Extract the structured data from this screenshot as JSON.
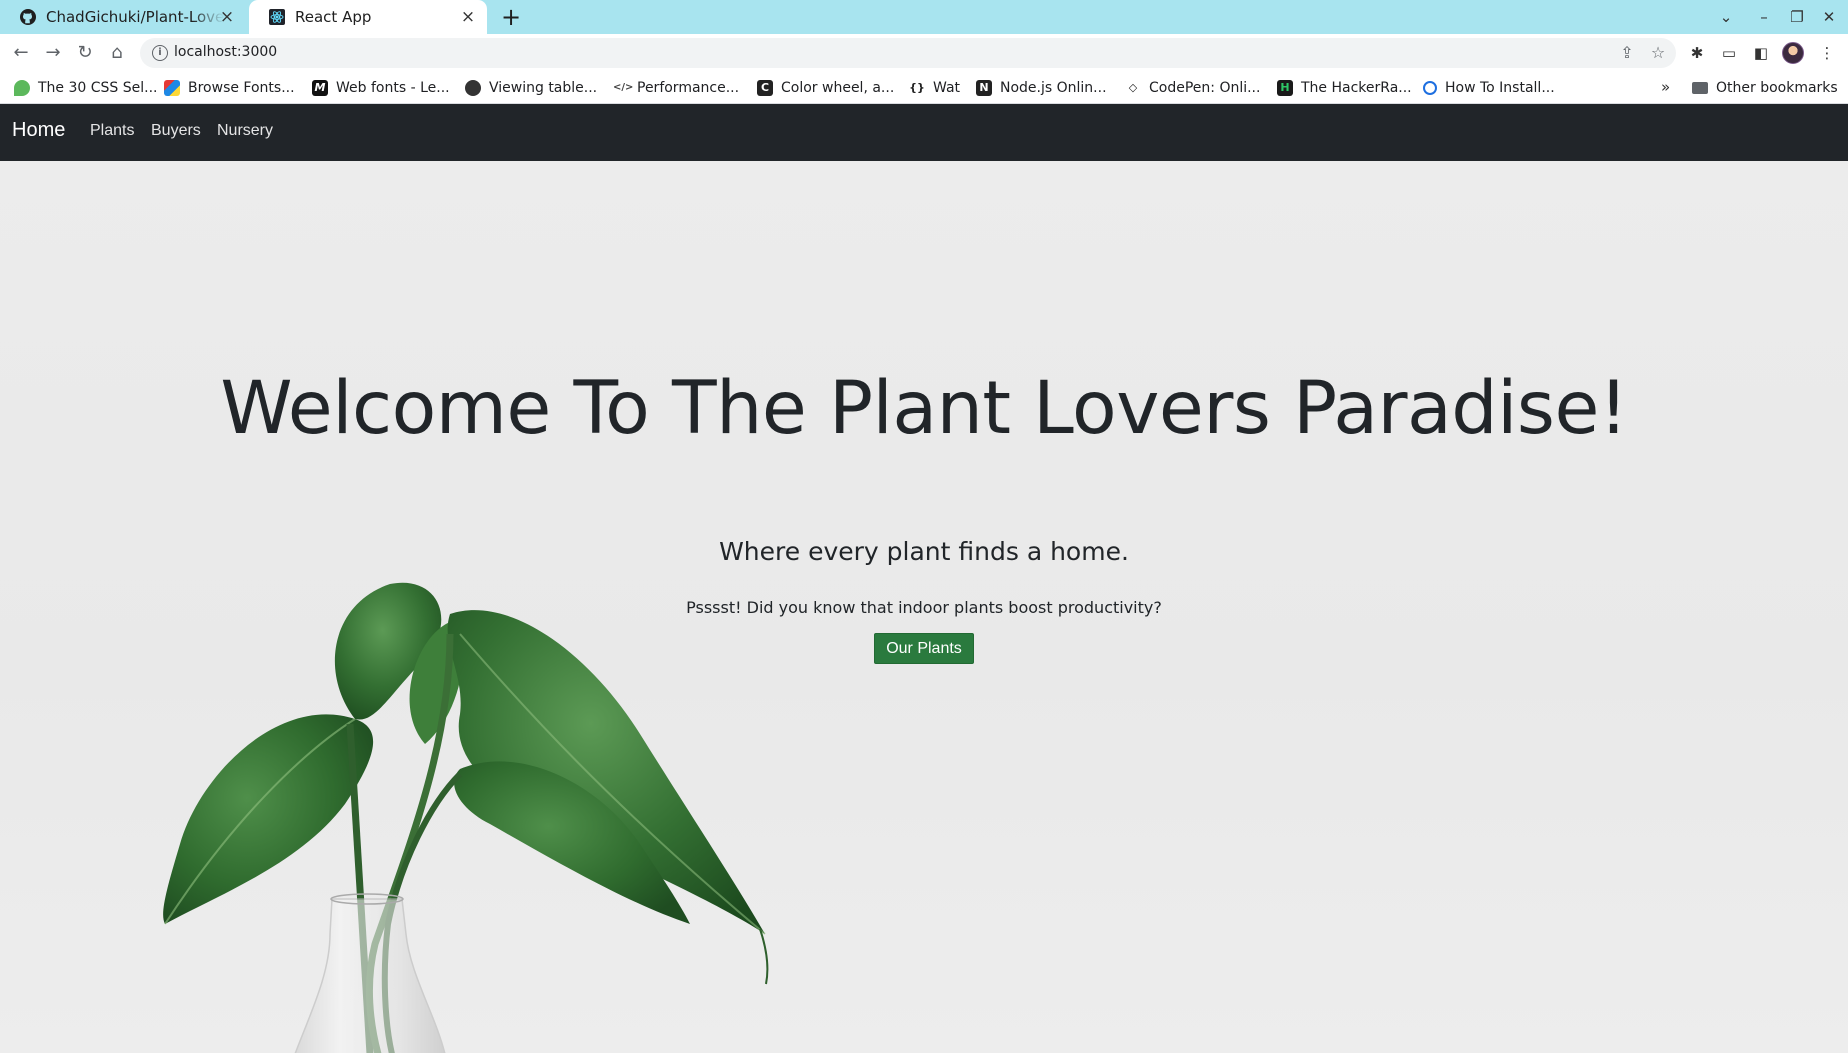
{
  "browser": {
    "tabs": [
      {
        "title": "ChadGichuki/Plant-Lovers"
      },
      {
        "title": "React App"
      }
    ],
    "address": "localhost:3000",
    "bookmarks": [
      {
        "label": "The 30 CSS Sel..."
      },
      {
        "label": "Browse Fonts..."
      },
      {
        "label": "Web fonts - Le..."
      },
      {
        "label": "Viewing table..."
      },
      {
        "label": "Performance..."
      },
      {
        "label": "Color wheel, a..."
      },
      {
        "label": "Wat"
      },
      {
        "label": "Node.js Onlin..."
      },
      {
        "label": "CodePen: Onli..."
      },
      {
        "label": "The HackerRa..."
      },
      {
        "label": "How To Install..."
      }
    ],
    "more_bookmarks": "»",
    "other_bookmarks": "Other bookmarks"
  },
  "app": {
    "nav": {
      "brand": "Home",
      "links": [
        "Plants",
        "Buyers",
        "Nursery"
      ]
    },
    "hero": {
      "title": "Welcome To The Plant Lovers Paradise!",
      "subtitle": "Where every plant finds a home.",
      "text": "Psssst! Did you know that indoor plants boost productivity?",
      "button": "Our Plants"
    },
    "colors": {
      "navbar": "#212529",
      "button": "#2a7a3e",
      "tabbar": "#a8e4ef"
    }
  }
}
